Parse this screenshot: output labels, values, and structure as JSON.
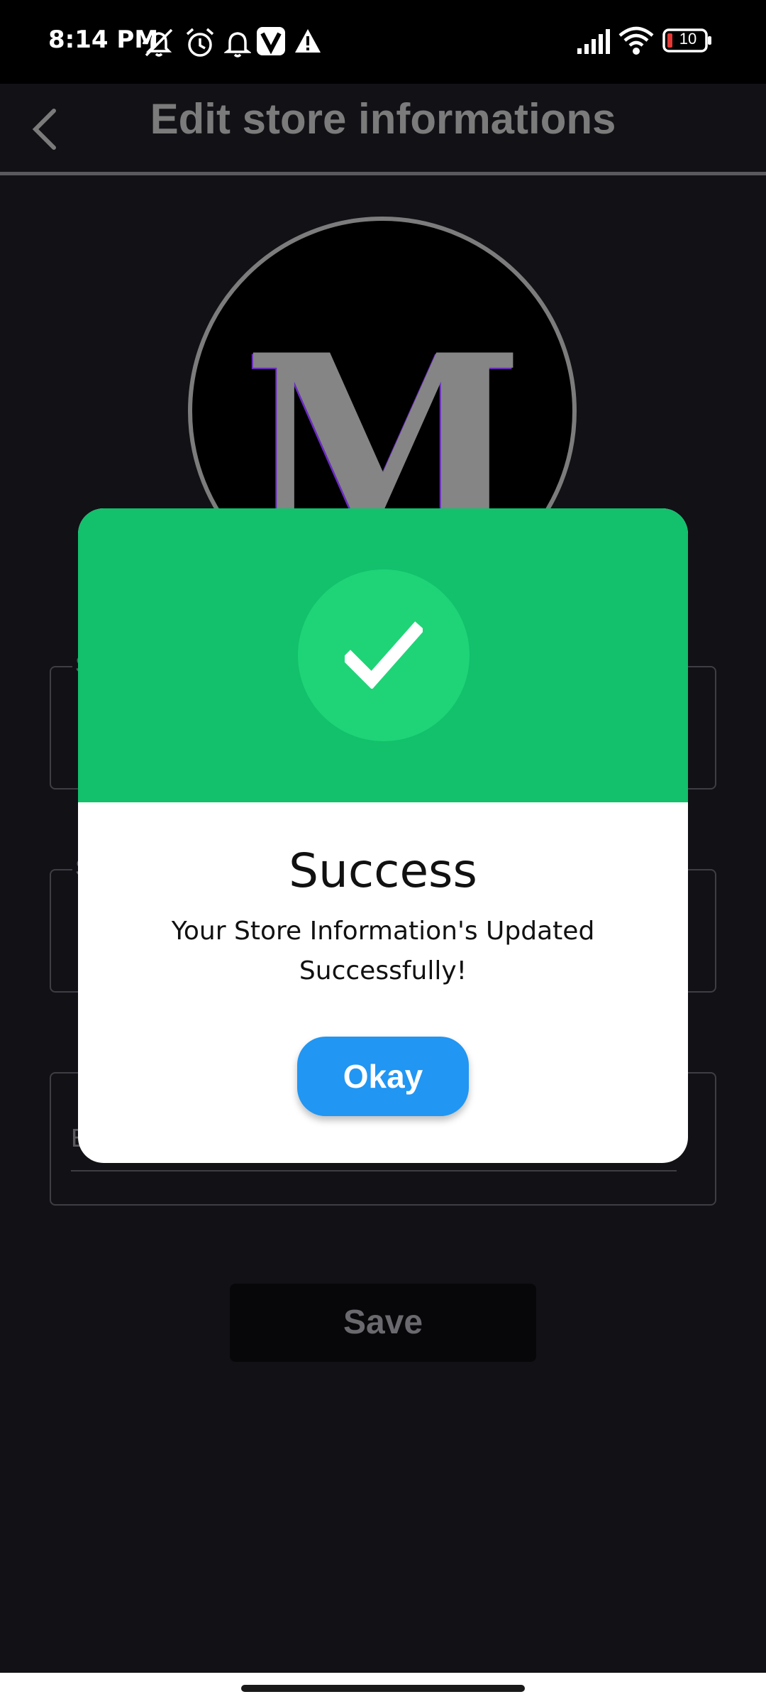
{
  "status_bar": {
    "time": "8:14 PM",
    "icons": [
      "mute-icon",
      "alarm-icon",
      "notification-bell-icon",
      "vivaldi-icon",
      "warning-icon",
      "signal-icon",
      "wifi-icon",
      "battery-icon"
    ],
    "battery_level": "10"
  },
  "header": {
    "title": "Edit store informations",
    "back_icon": "chevron-left-icon"
  },
  "avatar": {
    "letter": "M"
  },
  "form": {
    "field_1_label": "S",
    "field_2_label": "S",
    "field_3_hint": "E",
    "save_label": "Save"
  },
  "modal": {
    "icon": "check-icon",
    "title": "Success",
    "message": "Your Store Information's Updated Successfully!",
    "okay_label": "Okay"
  },
  "colors": {
    "background": "#111116",
    "success_green": "#13c06c",
    "badge_green": "#1ed477",
    "okay_blue": "#2196f3",
    "title_grey": "#7b7b7b"
  }
}
